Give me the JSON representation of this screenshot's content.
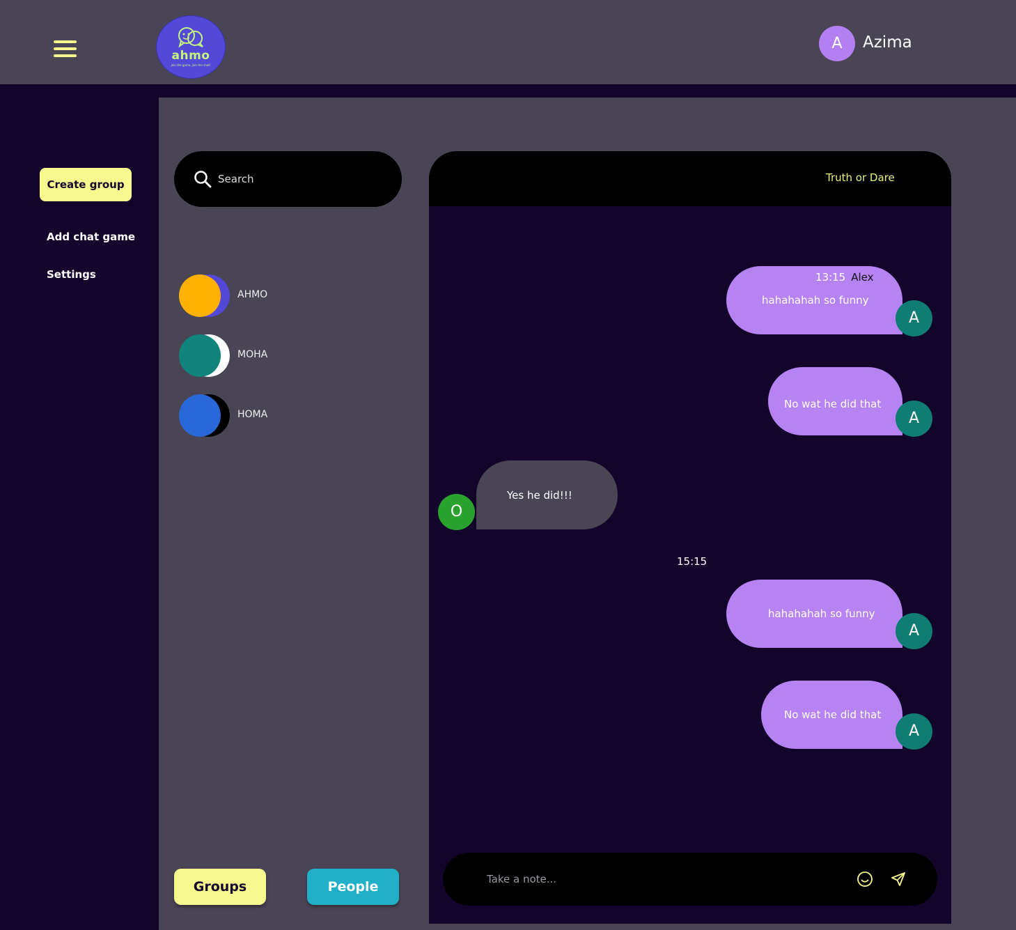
{
  "header": {
    "logo": {
      "word": "ahmo",
      "tagline": "join the game, join the chat!"
    },
    "user": {
      "initial": "A",
      "name": "Azima"
    }
  },
  "sidebar": {
    "create_group": "Create group",
    "items": [
      {
        "label": "Add chat game"
      },
      {
        "label": "Settings"
      }
    ]
  },
  "search": {
    "placeholder": "Search"
  },
  "contacts": [
    {
      "name": "AHMO",
      "color": "#ffb000",
      "back_color": "#5448d9"
    },
    {
      "name": "MOHA",
      "color": "#11847b",
      "back_color": "#ffffff"
    },
    {
      "name": "HOMA",
      "color": "#2868d8",
      "back_color": "#000000"
    }
  ],
  "tabs": {
    "groups": "Groups",
    "people": "People"
  },
  "chat": {
    "title": "Truth or Dare",
    "messages": [
      {
        "time": "13:15",
        "sender": "Alex",
        "text": "hahahahah so funny",
        "avatar": "A"
      },
      {
        "text": "No wat he did that",
        "avatar": "A"
      },
      {
        "text": "Yes he did!!!",
        "avatar": "O"
      },
      {
        "text": "hahahahah so funny",
        "avatar": "A"
      },
      {
        "text": "No wat he did that",
        "avatar": "A"
      }
    ],
    "divider_time": "15:15"
  },
  "composer": {
    "placeholder": "Take a note..."
  },
  "colors": {
    "accent_yellow": "#f7f98f",
    "bubble_purple": "#b783f2",
    "avatar_teal": "#0f7d74",
    "people_cyan": "#20b0c8"
  }
}
